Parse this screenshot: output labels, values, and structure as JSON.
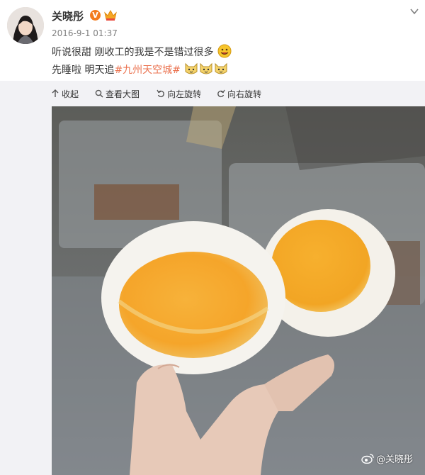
{
  "post": {
    "author": "关晓彤",
    "date": "2016-9-1 01:37",
    "line1_text": "听说很甜 刚收工的我是不是错过很多",
    "line2_text": "先睡啦 明天追",
    "topic": "#九州天空城#",
    "line1_emoji": "drooling-face-emoji",
    "line2_emojis": [
      "cat-emoji",
      "cat-emoji",
      "cat-emoji"
    ],
    "badges": [
      "verified-v-icon",
      "crown-member-icon"
    ]
  },
  "toolbar": {
    "collapse": "收起",
    "view_large": "查看大图",
    "rotate_left": "向左旋转",
    "rotate_right": "向右旋转"
  },
  "photo": {
    "subject": "two-salted-egg-halves-held-in-hand",
    "watermark": "@关晓彤"
  },
  "colors": {
    "topic_link": "#eb7350",
    "verified_badge": "#f37b1d",
    "toolbar_bg": "#f2f2f5",
    "date_text": "#808080"
  }
}
